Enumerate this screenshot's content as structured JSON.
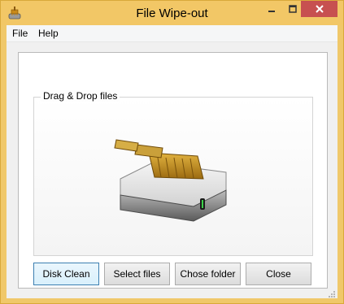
{
  "window": {
    "title": "File Wipe-out",
    "icon": "brush-drive-icon",
    "controls": {
      "minimize": "minimize-icon",
      "maximize": "maximize-icon",
      "close": "close-icon"
    },
    "accent_color": "#f2c766",
    "close_color": "#c75050"
  },
  "menu": {
    "items": [
      {
        "label": "File"
      },
      {
        "label": "Help"
      }
    ]
  },
  "dropzone": {
    "label": "Drag & Drop files",
    "image": "hard-drive-brush-icon"
  },
  "buttons": {
    "disk_clean": "Disk Clean",
    "select_files": "Select files",
    "choose_folder": "Chose folder",
    "close": "Close"
  }
}
